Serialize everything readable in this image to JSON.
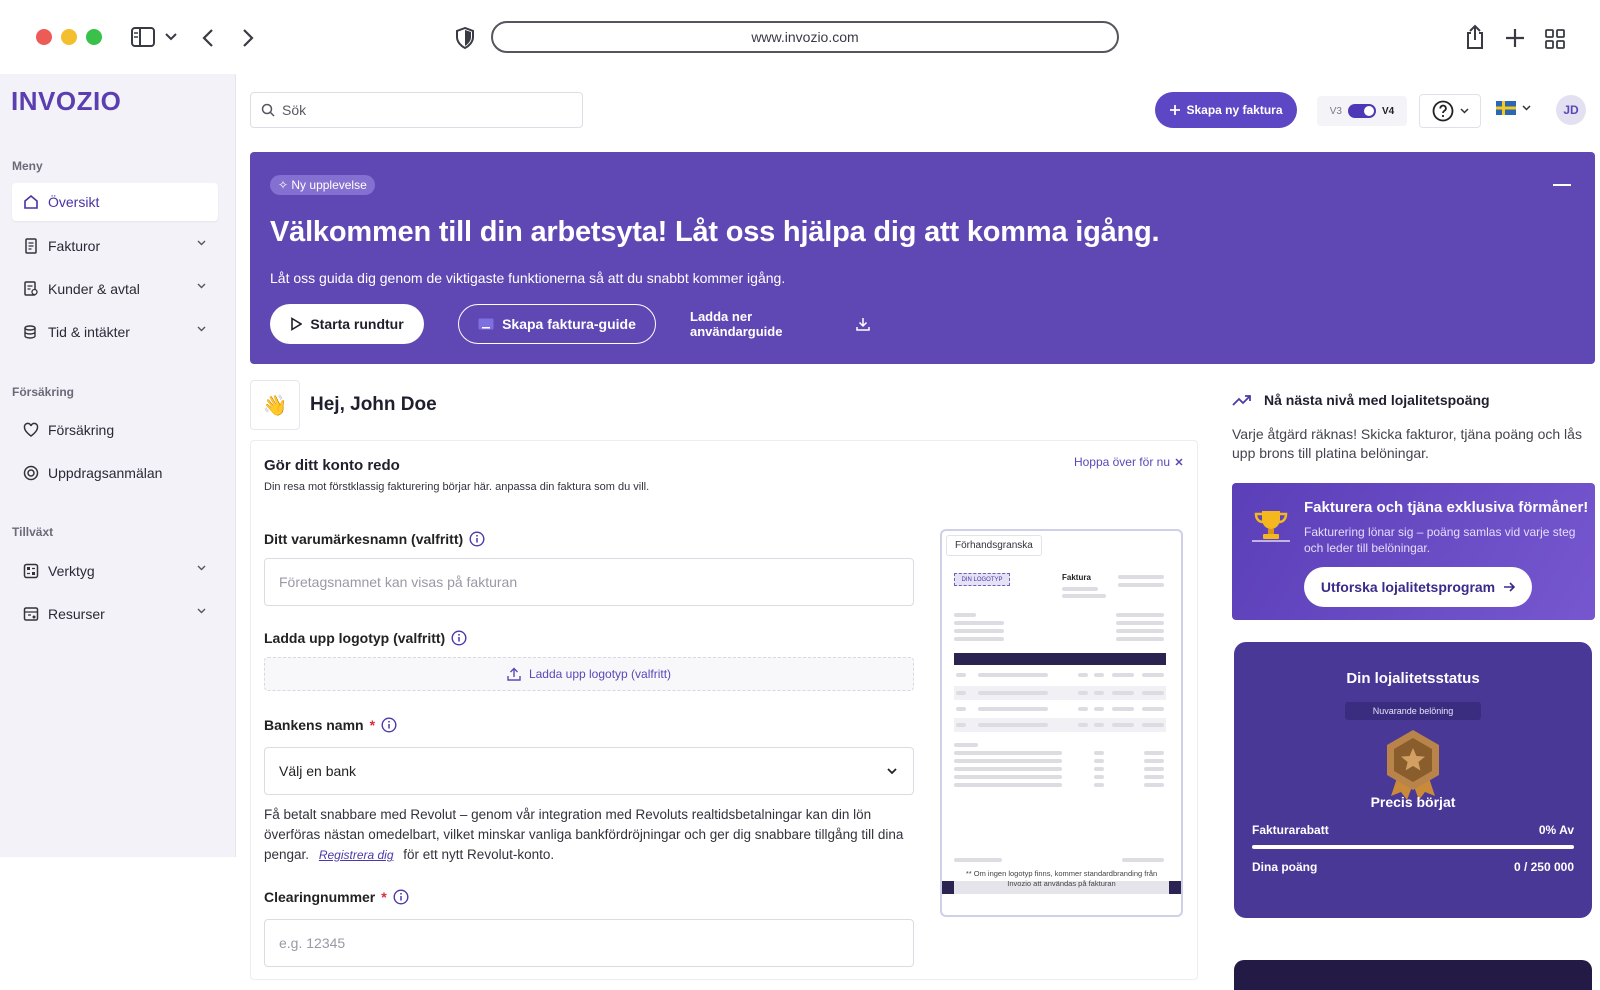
{
  "browser": {
    "url": "www.invozio.com"
  },
  "brand": {
    "logo_text": "INVOZIO",
    "accent": "#5e47c4"
  },
  "sidebar": {
    "sections": [
      {
        "title": "Meny"
      },
      {
        "title": "Försäkring"
      },
      {
        "title": "Tillväxt"
      }
    ],
    "items": [
      {
        "label": "Översikt",
        "icon": "home-icon",
        "active": true
      },
      {
        "label": "Fakturor",
        "icon": "invoice-icon"
      },
      {
        "label": "Kunder & avtal",
        "icon": "customers-icon"
      },
      {
        "label": "Tid & intäkter",
        "icon": "coins-icon"
      },
      {
        "label": "Försäkring",
        "icon": "heart-icon"
      },
      {
        "label": "Uppdragsanmälan",
        "icon": "target-icon"
      },
      {
        "label": "Verktyg",
        "icon": "tools-icon"
      },
      {
        "label": "Resurser",
        "icon": "resources-icon"
      }
    ]
  },
  "topbar": {
    "search_placeholder": "Sök",
    "new_invoice": "Skapa ny faktura",
    "version_left": "V3",
    "version_right": "V4",
    "avatar": "JD"
  },
  "hero": {
    "badge": "Ny upplevelse",
    "title": "Välkommen till din arbetsyta! Låt oss hjälpa dig att komma igång.",
    "subtitle": "Låt oss guida dig genom de viktigaste funktionerna så att du snabbt kommer igång.",
    "btn_tour": "Starta rundtur",
    "btn_guide": "Skapa faktura-guide",
    "btn_download": "Ladda ner användarguide"
  },
  "greeting": {
    "text": "Hej, John Doe"
  },
  "setup": {
    "title": "Gör ditt konto redo",
    "subtitle": "Din resa mot förstklassig fakturering börjar här. anpassa din faktura som du vill.",
    "skip": "Hoppa över för nu",
    "brand_label": "Ditt varumärkesnamn (valfritt)",
    "brand_placeholder": "Företagsnamnet kan visas på fakturan",
    "logo_label": "Ladda upp logotyp (valfritt)",
    "logo_upload": "Ladda upp logotyp (valfritt)",
    "bank_label": "Bankens namn",
    "bank_value": "Välj en bank",
    "revolut_text": "Få betalt snabbare med Revolut – genom vår integration med Revoluts realtidsbetalningar kan din lön överföras nästan omedelbart, vilket minskar vanliga bankfördröjningar och ger dig snabbare tillgång till dina pengar.",
    "revolut_link": "Registrera dig",
    "revolut_tail": "för ett nytt Revolut-konto.",
    "clearing_label": "Clearingnummer",
    "clearing_placeholder": "e.g. 12345",
    "preview_tab": "Förhandsgranska",
    "preview_logo": "DIN LOGOTYP",
    "preview_title": "Faktura",
    "preview_note": "** Om ingen logotyp finns, kommer standardbranding från Invozio att användas på fakturan"
  },
  "loyalty": {
    "heading": "Nå nästa nivå med lojalitetspoäng",
    "text": "Varje åtgärd räknas! Skicka fakturor, tjäna poäng och lås upp brons till platina belöningar.",
    "promo_title": "Fakturera och tjäna exklusiva förmåner!",
    "promo_text": "Fakturering lönar sig – poäng samlas vid varje steg och leder till belöningar.",
    "promo_btn": "Utforska lojalitetsprogram",
    "status_title": "Din lojalitetsstatus",
    "status_badge": "Nuvarande belöning",
    "status_level": "Precis börjat",
    "discount_label": "Fakturarabatt",
    "discount_value": "0% Av",
    "points_label": "Dina poäng",
    "points_value": "0 / 250 000"
  }
}
